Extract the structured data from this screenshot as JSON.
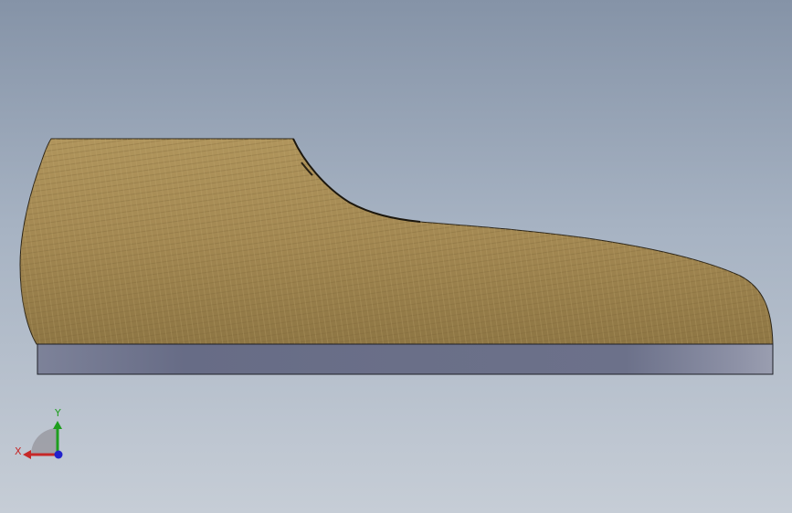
{
  "viewport": {
    "background_top": "#8593a7",
    "background_bottom": "#c6cdd6"
  },
  "model": {
    "shoe_last_color": "#a88c55",
    "sole_plate_color": "#737892"
  },
  "triad": {
    "x_label": "X",
    "y_label": "Y",
    "x_color": "#c62828",
    "y_color": "#1e9e1e",
    "z_color": "#2222cc"
  }
}
